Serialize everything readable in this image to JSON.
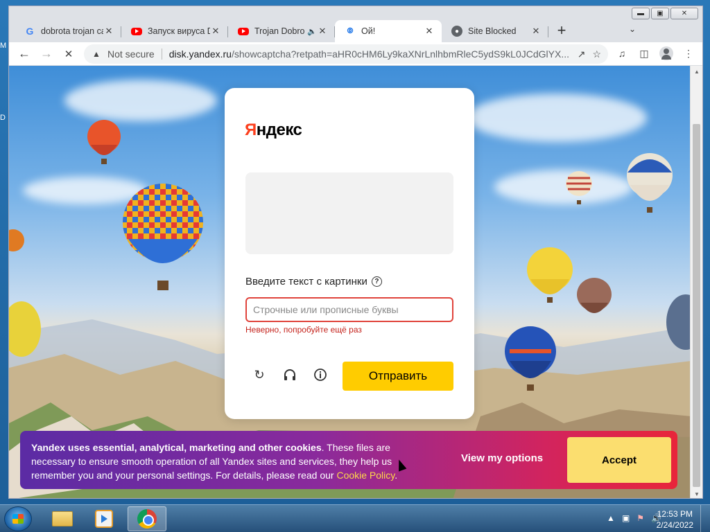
{
  "browser": {
    "tabs": [
      {
        "title": "dobrota trojan ca",
        "favicon": "google-icon"
      },
      {
        "title": "Запуск вируса D",
        "favicon": "youtube-icon"
      },
      {
        "title": "Trojan Dobro",
        "favicon": "youtube-icon"
      },
      {
        "title": "Ой!",
        "favicon": "yandex-icon"
      },
      {
        "title": "Site Blocked",
        "favicon": "globe-icon"
      }
    ],
    "not_secure": "Not secure",
    "url_host": "disk.yandex.ru",
    "url_rest": "/showcaptcha?retpath=aHR0cHM6Ly9kaXNrLnlhbmRleC5ydS9kL0JCdGlYX..."
  },
  "captcha": {
    "logo_first": "Я",
    "logo_rest": "ндекс",
    "label": "Введите текст с картинки",
    "help": "?",
    "placeholder": "Строчные или прописные буквы",
    "error": "Неверно, попробуйте ещё раз",
    "submit": "Отправить"
  },
  "cookie": {
    "bold": "Yandex uses essential, analytical, marketing and other cookies",
    "text": ". These files are necessary to ensure smooth operation of all Yandex sites and services, they help us remember you and your personal settings. For details, please read our ",
    "link": "Cookie Policy",
    "end": ".",
    "view_options": "View my options",
    "accept": "Accept"
  },
  "taskbar": {
    "time": "12:53 PM",
    "date": "2/24/2022"
  },
  "colors": {
    "yandex_red": "#fc3f1d",
    "submit_yellow": "#ffcc00",
    "error_red": "#e0433b"
  }
}
